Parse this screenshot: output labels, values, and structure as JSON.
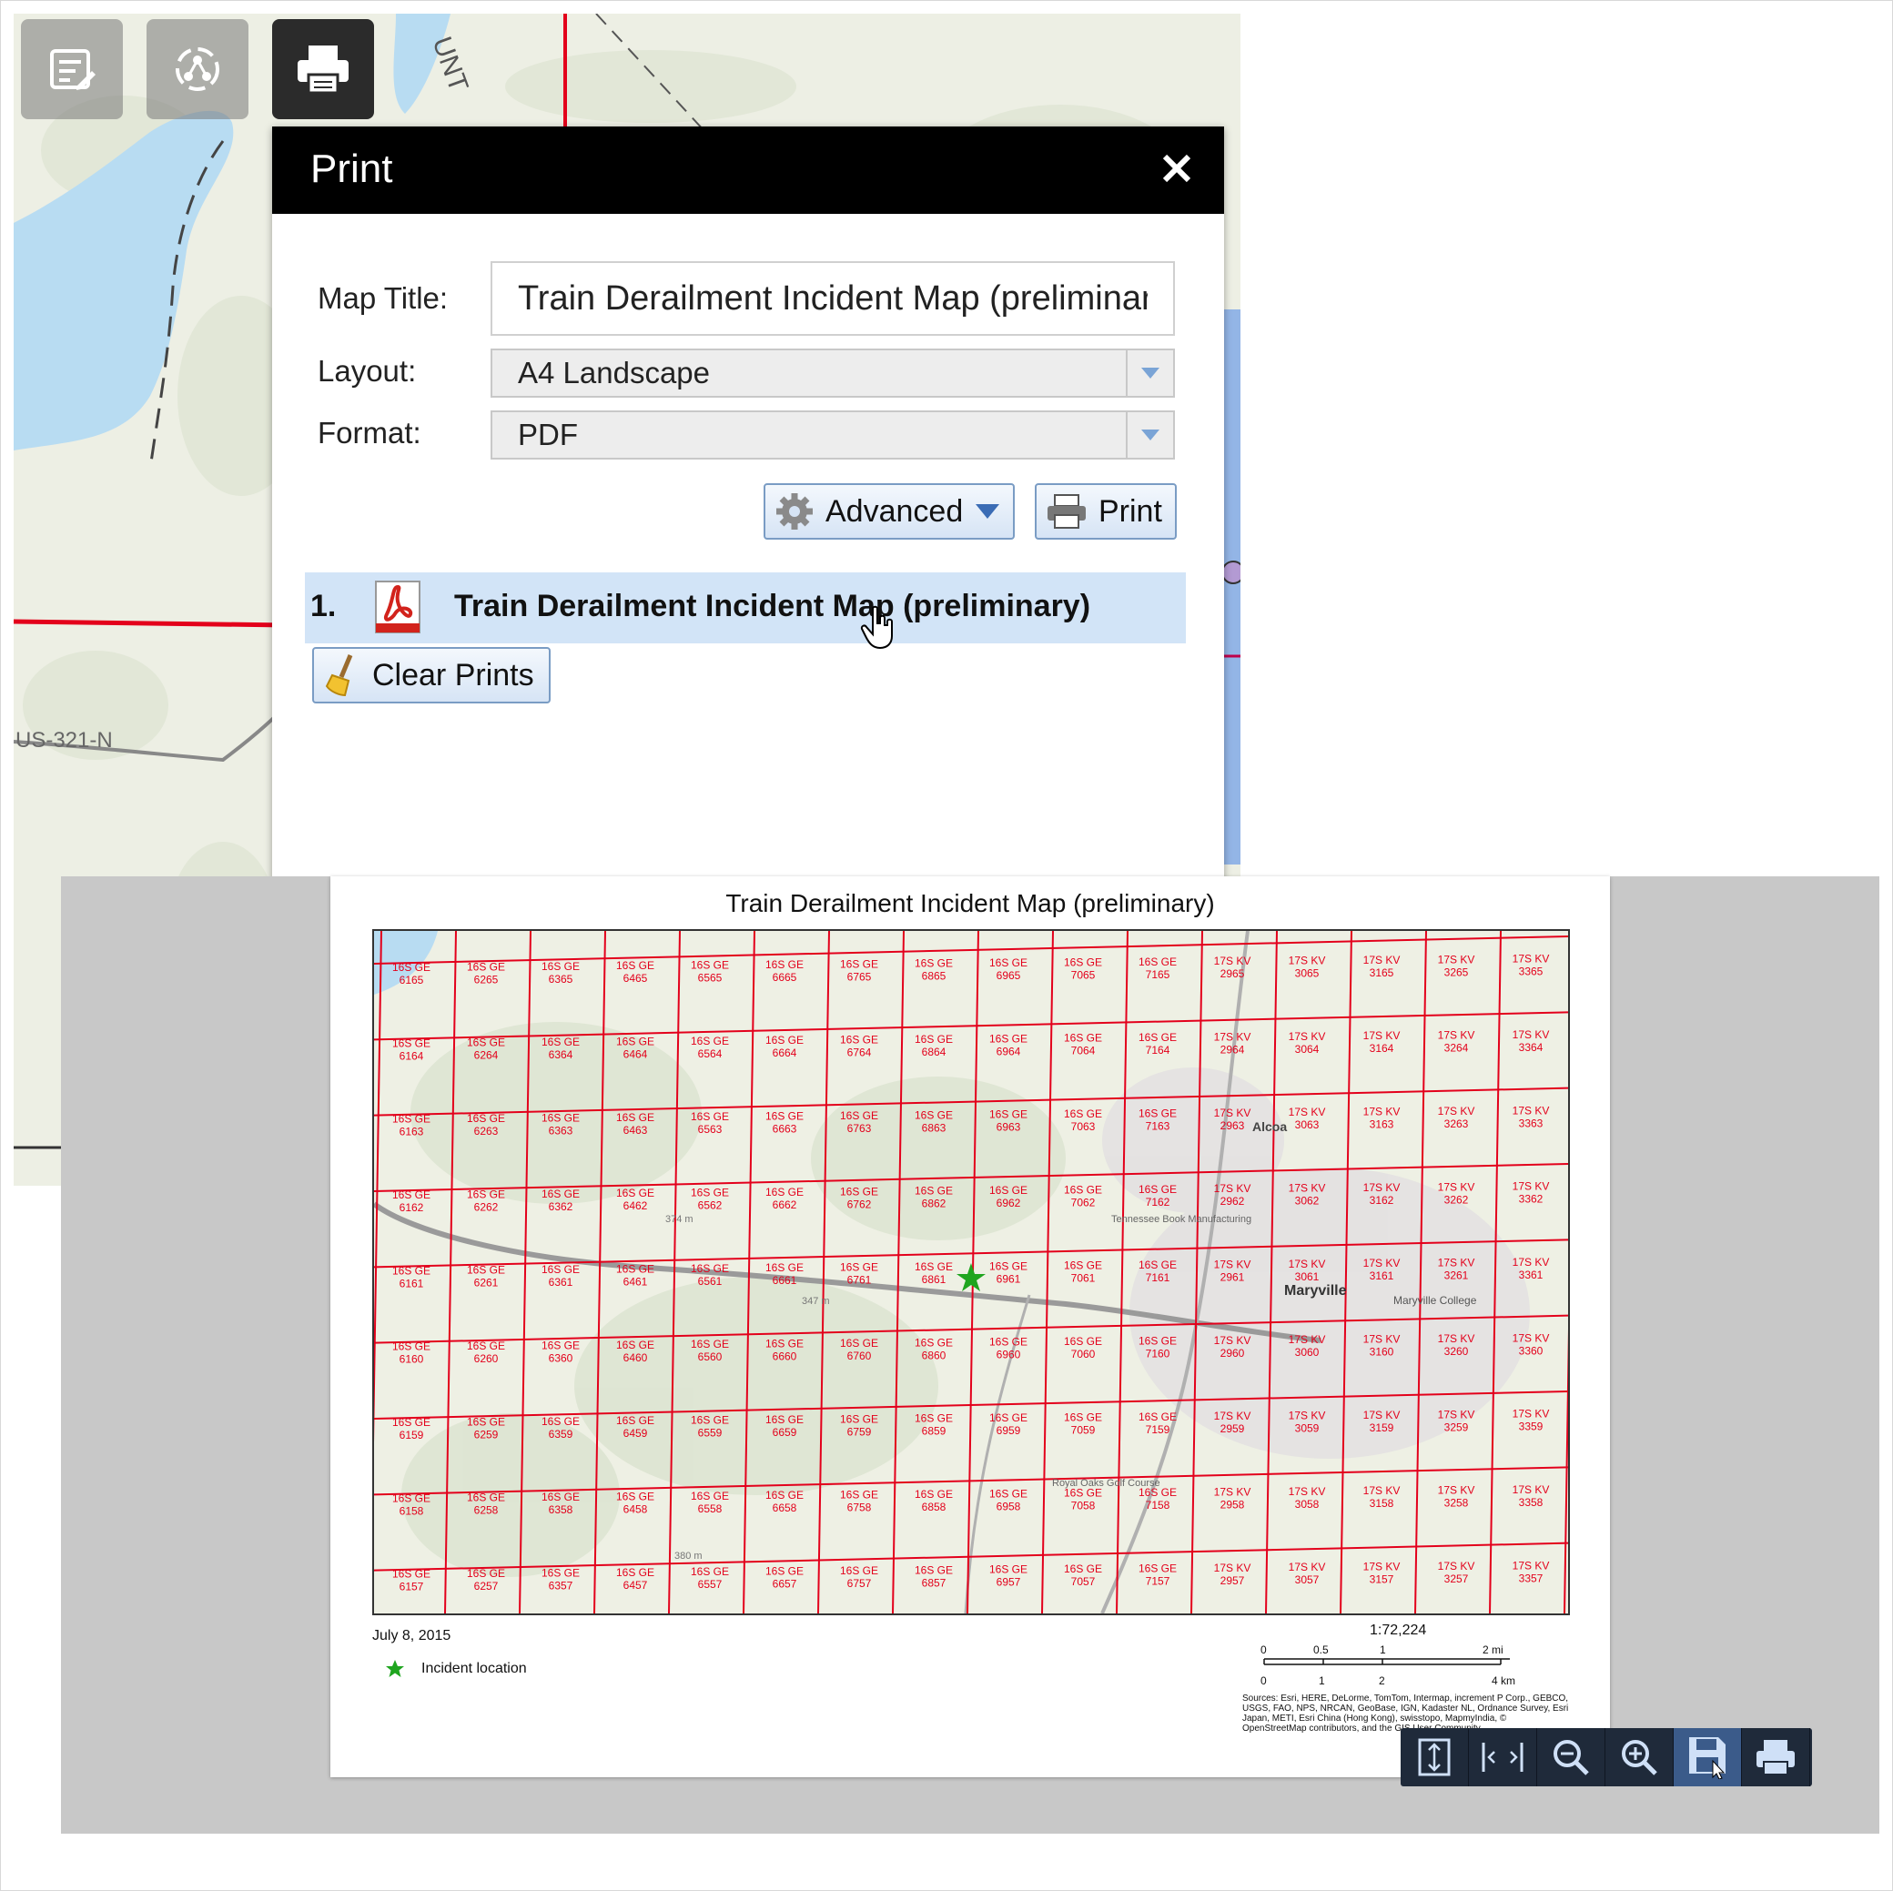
{
  "webmap": {
    "road_label": "US-321-N",
    "label_partial": "UNT"
  },
  "toolbar": {
    "tools": [
      {
        "name": "edit-widget-button",
        "icon": "edit-list-icon"
      },
      {
        "name": "analysis-widget-button",
        "icon": "network-icon"
      },
      {
        "name": "print-widget-button",
        "icon": "printer-icon"
      }
    ]
  },
  "print_panel": {
    "title": "Print",
    "close_icon": "close-icon",
    "map_title_label": "Map Title:",
    "map_title_value": "Train Derailment Incident Map (preliminary)",
    "layout_label": "Layout:",
    "layout_value": "A4 Landscape",
    "format_label": "Format:",
    "format_value": "PDF",
    "advanced_label": "Advanced",
    "print_label": "Print",
    "results": [
      {
        "number": "1.",
        "title": "Train Derailment Incident Map (preliminary)",
        "icon": "pdf-file-icon"
      }
    ],
    "clear_label": "Clear Prints"
  },
  "pdf": {
    "title": "Train Derailment Incident Map (preliminary)",
    "date": "July 8, 2015",
    "legend_label": "Incident location",
    "scale": "1:72,224",
    "scale_mi_ticks": [
      "0",
      "0.5",
      "1",
      "2 mi"
    ],
    "scale_km_ticks": [
      "0",
      "1",
      "2",
      "4 km"
    ],
    "sources": "Sources: Esri, HERE, DeLorme, TomTom, Intermap, increment P Corp., GEBCO, USGS, FAO, NPS, NRCAN, GeoBase, IGN, Kadaster NL, Ordnance Survey, Esri Japan, METI, Esri China (Hong Kong), swisstopo, MapmyIndia, © OpenStreetMap contributors, and the GIS User Community",
    "place_labels": [
      "Alcoa",
      "Maryville",
      "Maryville College",
      "Tennessee Book Manufacturing",
      "Royal Oaks Golf Course",
      "374 m",
      "347 m",
      "380 m"
    ],
    "grid": {
      "ge_cols": [
        "61",
        "62",
        "63",
        "64",
        "65",
        "66",
        "67",
        "68",
        "69",
        "70",
        "71"
      ],
      "kv_cols": [
        "29",
        "30",
        "31",
        "32",
        "33"
      ],
      "rows": [
        "65",
        "64",
        "63",
        "62",
        "61",
        "60",
        "59",
        "58",
        "57"
      ],
      "ge_prefix": "16S GE",
      "kv_prefix": "17S KV"
    }
  },
  "viewer_toolbar": [
    {
      "name": "fit-page-button",
      "icon": "fit-page-icon"
    },
    {
      "name": "fit-width-button",
      "icon": "fit-width-icon"
    },
    {
      "name": "zoom-out-button",
      "icon": "zoom-out-icon"
    },
    {
      "name": "zoom-in-button",
      "icon": "zoom-in-icon"
    },
    {
      "name": "save-button",
      "icon": "save-icon"
    },
    {
      "name": "print-document-button",
      "icon": "printer-icon"
    }
  ],
  "colors": {
    "grid_line": "#e3001b",
    "panel_header": "#000000",
    "result_highlight": "#d2e4f7",
    "water": "#b8dcf2",
    "incident_marker": "#1fa51f"
  }
}
